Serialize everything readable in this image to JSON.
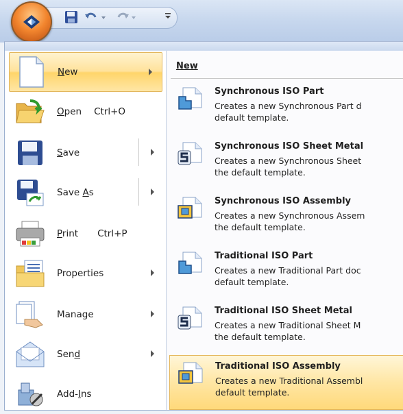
{
  "app_menu": {
    "items": [
      {
        "label_pre": "",
        "accel": "N",
        "label_post": "ew",
        "shortcut": "",
        "icon": "new-document-icon"
      },
      {
        "label_pre": "",
        "accel": "O",
        "label_post": "pen",
        "shortcut": "Ctrl+O",
        "icon": "open-folder-icon"
      },
      {
        "label_pre": "",
        "accel": "S",
        "label_post": "ave",
        "shortcut": "",
        "icon": "save-icon"
      },
      {
        "label_pre": "Save ",
        "accel": "A",
        "label_post": "s",
        "shortcut": "",
        "icon": "save-as-icon"
      },
      {
        "label_pre": "",
        "accel": "P",
        "label_post": "rint",
        "shortcut": "Ctrl+P",
        "icon": "printer-icon"
      },
      {
        "label_pre": "Properties",
        "accel": "",
        "label_post": "",
        "shortcut": "",
        "icon": "properties-icon"
      },
      {
        "label_pre": "Manage",
        "accel": "",
        "label_post": "",
        "shortcut": "",
        "icon": "manage-icon"
      },
      {
        "label_pre": "Sen",
        "accel": "d",
        "label_post": "",
        "shortcut": "",
        "icon": "send-envelope-icon"
      },
      {
        "label_pre": "Add-",
        "accel": "I",
        "label_post": "ns",
        "shortcut": "",
        "icon": "add-ins-icon"
      }
    ]
  },
  "new_panel": {
    "title": "New",
    "templates": [
      {
        "name": "Synchronous ISO Part",
        "line1": "Creates a new Synchronous Part d",
        "line2": "default template.",
        "icon": "part-document-icon"
      },
      {
        "name": "Synchronous ISO Sheet Metal",
        "line1": "Creates a new Synchronous Sheet",
        "line2": "the default template.",
        "icon": "sheet-metal-document-icon"
      },
      {
        "name": "Synchronous ISO Assembly",
        "line1": "Creates a new Synchronous Assem",
        "line2": "the default template.",
        "icon": "assembly-document-icon"
      },
      {
        "name": "Traditional ISO Part",
        "line1": "Creates a new Traditional Part doc",
        "line2": "default template.",
        "icon": "part-document-icon"
      },
      {
        "name": "Traditional ISO Sheet Metal",
        "line1": "Creates a new Traditional Sheet M",
        "line2": "the default template.",
        "icon": "sheet-metal-document-icon"
      },
      {
        "name": "Traditional ISO Assembly",
        "line1": "Creates a new Traditional Assembl",
        "line2": "default template.",
        "icon": "assembly-document-icon"
      }
    ]
  },
  "colors": {
    "highlight": "#ffe29b",
    "highlight_border": "#e2b65c",
    "orb": "#f2852e",
    "frame": "#9bb0cf"
  }
}
